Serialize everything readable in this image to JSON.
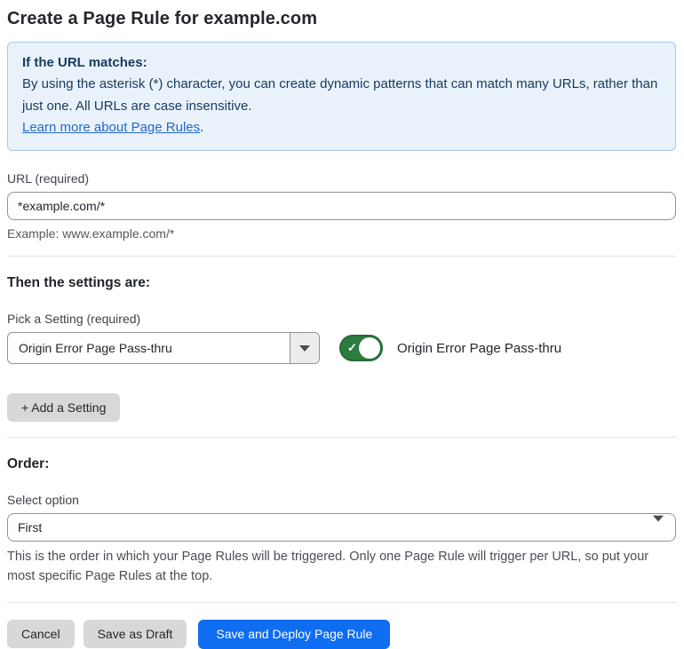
{
  "page": {
    "title": "Create a Page Rule for example.com"
  },
  "info_box": {
    "heading": "If the URL matches:",
    "body": "By using the asterisk (*) character, you can create dynamic patterns that can match many URLs, rather than just one. All URLs are case insensitive.",
    "link": "Learn more about Page Rules",
    "link_suffix": "."
  },
  "url_field": {
    "label": "URL (required)",
    "value": "*example.com/*",
    "helper": "Example: www.example.com/*"
  },
  "settings_section": {
    "heading": "Then the settings are:",
    "picker_label": "Pick a Setting (required)",
    "picker_value": "Origin Error Page Pass-thru",
    "toggle_state": "on",
    "toggle_check": "✓",
    "toggle_label": "Origin Error Page Pass-thru",
    "add_button": "+ Add a Setting"
  },
  "order_section": {
    "heading": "Order:",
    "select_label": "Select option",
    "select_value": "First",
    "helper": "This is the order in which your Page Rules will be triggered. Only one Page Rule will trigger per URL, so put your most specific Page Rules at the top."
  },
  "footer": {
    "cancel": "Cancel",
    "save_draft": "Save as Draft",
    "save_deploy": "Save and Deploy Page Rule"
  },
  "colors": {
    "accent_blue": "#0f6df2",
    "toggle_green": "#2c7b3f",
    "info_background": "#e9f2fb",
    "info_border": "#a9c7e8",
    "info_text": "#17395f",
    "link_blue": "#2667c9"
  }
}
